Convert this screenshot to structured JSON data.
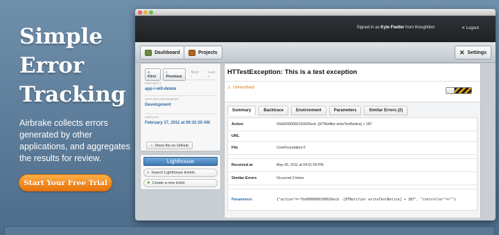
{
  "hero": {
    "title_lines": [
      "Simple",
      "Error",
      "Tracking"
    ],
    "description": "Airbrake collects errors generated by other applications, and aggregates the results for review.",
    "cta_label": "Start Your Free Trial"
  },
  "app": {
    "signed_in_prefix": "Signed in as",
    "user": "Kyle Fiedler",
    "signed_in_suffix": "from thoughtbot",
    "logout_label": "Logout",
    "nav": {
      "dashboard_label": "Dashboard",
      "projects_label": "Projects",
      "settings_label": "Settings"
    },
    "sidebar": {
      "pager": [
        "« First",
        "‹ Previous",
        "Next ›",
        "Last »"
      ],
      "project_label": "PROJECT",
      "project_value": "app-i-will-delete",
      "env_label": "APP ENVIRONMENT",
      "env_value": "Development",
      "deploy_label": "DEPLOY",
      "deploy_value": "February 17, 2011 at 09:32:35 AM",
      "github_label": "Show file on GitHub"
    },
    "lighthouse": {
      "logo": "Lighthouse",
      "search_label": "Search Lighthouse tickets",
      "create_label": "Create a new ticket"
    },
    "error": {
      "title": "HTTestException: This is a test exception",
      "status": "Unresolved",
      "tabs": [
        "Summary",
        "Backtrace",
        "Environment",
        "Parameters",
        "Similar Errors (2)"
      ],
      "rows": {
        "action_key": "Action",
        "action_val": "#0x00000000100026ecb -[HTNotifier writeTestNotice] + 187",
        "url_key": "URL",
        "url_val": "",
        "file_key": "File",
        "file_val": "CoreFoundation:0",
        "received_key": "Received at",
        "received_val": "May 26, 2011 at 04:51:59 PM",
        "similar_key": "Similar Errors",
        "similar_val": "Occurred 2 times",
        "params_key": "Parameters",
        "params_val": "{\"action\"=>\"0x0000000100026ecb -[HTNotifier writeTestNotice] + 187\", \"controller\"=>\"\"}"
      }
    }
  },
  "colors": {
    "cta_orange": "#f48a1c",
    "link_blue": "#2e6aa8",
    "status_orange": "#d8750f"
  }
}
